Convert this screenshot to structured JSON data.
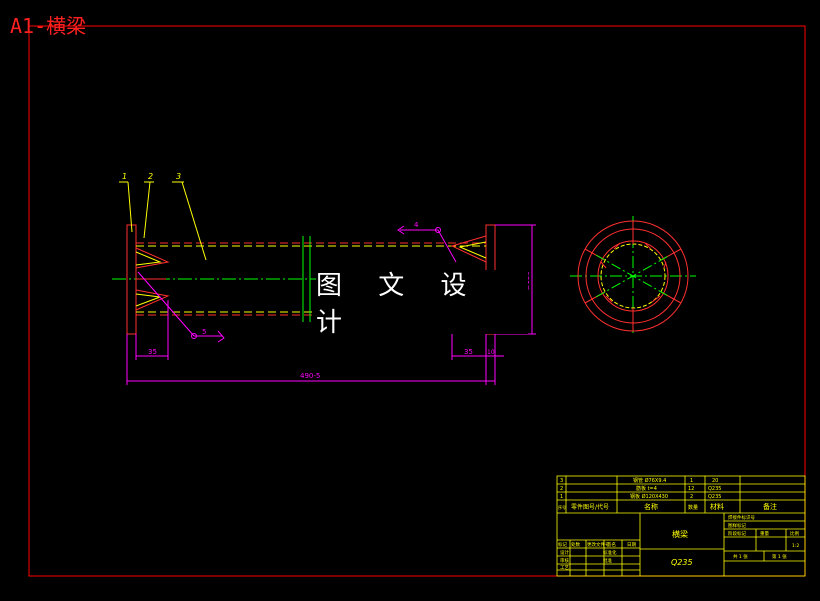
{
  "title": "A1-横梁",
  "watermark": "图 文 设 计",
  "colors": {
    "frame": "#ff0000",
    "outline": "#ff3030",
    "center": "#00ff00",
    "hidden": "#ffff00",
    "dim": "#ff00ff",
    "table": "#ffff00",
    "text": "#ffffff"
  },
  "balloons": [
    "1",
    "2",
    "3"
  ],
  "dims": {
    "left_len": "35",
    "right_len": "35",
    "flange_th": "10",
    "total_len": "490-5",
    "diameter": "Ø120",
    "weld_top": "4",
    "weld_bottom": "5"
  },
  "bom": {
    "rows": [
      {
        "no": "3",
        "code": "",
        "name": "钢管 Ø76X9.4",
        "qty": "1",
        "material": "20",
        "note": ""
      },
      {
        "no": "2",
        "code": "",
        "name": "筋板 t=4",
        "qty": "12",
        "material": "Q235",
        "note": ""
      },
      {
        "no": "1",
        "code": "",
        "name": "钢板 Ø120X430",
        "qty": "2",
        "material": "Q235",
        "note": ""
      }
    ],
    "header": {
      "no": "序号",
      "code": "零件图号/代号",
      "name": "名称",
      "qty": "数量",
      "material": "材料",
      "note": "备注"
    }
  },
  "title_block": {
    "part_name": "横梁",
    "material": "Q235",
    "stage_label": "阶段标记",
    "weight_label": "重量",
    "scale_label": "比例",
    "scale_value": "1:2",
    "sheet_label": "共 1 张",
    "sheet_no": "第 1 张",
    "process_label": "焊接件标识号",
    "process_label2": "图样标记",
    "designer": "设计",
    "checker": "审核",
    "std_check": "标准化",
    "approve": "批准",
    "craft": "工艺",
    "mark": "标记",
    "count": "处数",
    "change_doc": "更改文件号",
    "sign": "签名",
    "date": "日期"
  }
}
